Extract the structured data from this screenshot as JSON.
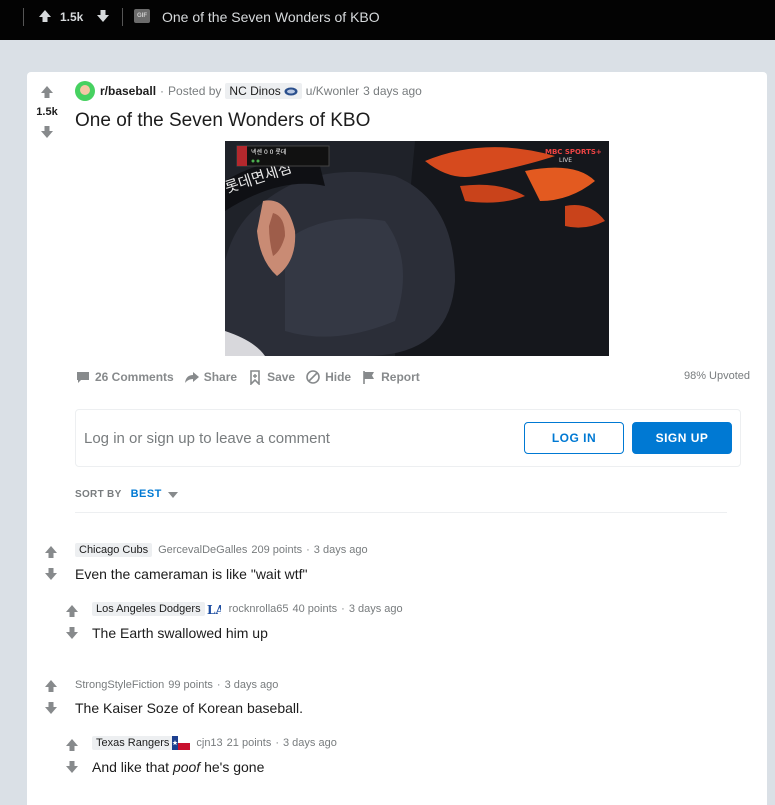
{
  "topbar": {
    "score": "1.5k",
    "gif_label": "GIF",
    "title": "One of the Seven Wonders of KBO"
  },
  "post": {
    "score": "1.5k",
    "subreddit": "r/baseball",
    "posted_by": "Posted by",
    "flair": "NC Dinos",
    "author": "u/Kwonler",
    "time": "3 days ago",
    "title": "One of the Seven Wonders of KBO",
    "media_overlay": {
      "broadcaster": "MBC SPORTS+",
      "live": "LIVE",
      "helmet_text": "롯데면세점",
      "score_top": "넥센 0  0 롯데"
    },
    "actions": {
      "comments": "26 Comments",
      "share": "Share",
      "save": "Save",
      "hide": "Hide",
      "report": "Report"
    },
    "upvoted": "98% Upvoted"
  },
  "login_prompt": {
    "text": "Log in or sign up to leave a comment",
    "login": "LOG IN",
    "signup": "SIGN UP"
  },
  "sort": {
    "label": "SORT BY",
    "value": "BEST"
  },
  "comments": [
    {
      "flair": "Chicago Cubs",
      "author": "GercevalDeGalles",
      "points": "209 points",
      "sep": "·",
      "time": "3 days ago",
      "body": "Even the cameraman is like \"wait wtf\""
    },
    {
      "flair": "Los Angeles Dodgers",
      "author": "rocknrolla65",
      "points": "40 points",
      "sep": "·",
      "time": "3 days ago",
      "body": "The Earth swallowed him up"
    },
    {
      "flair": "",
      "author": "StrongStyleFiction",
      "points": "99 points",
      "sep": "·",
      "time": "3 days ago",
      "body": "The Kaiser Soze of Korean baseball."
    },
    {
      "flair": "Texas Rangers",
      "author": "cjn13",
      "points": "21 points",
      "sep": "·",
      "time": "3 days ago",
      "body_before": "And like that ",
      "body_em": "poof",
      "body_after": " he's gone"
    }
  ],
  "colors": {
    "accent": "#0079d3",
    "topbar": "#030303",
    "background": "#dae0e6",
    "meta": "#787c7e"
  }
}
